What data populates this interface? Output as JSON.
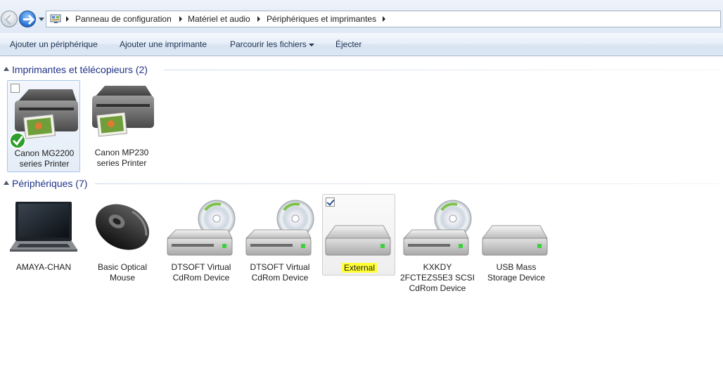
{
  "address": {
    "breadcrumb": [
      "Panneau de configuration",
      "Matériel et audio",
      "Périphériques et imprimantes"
    ],
    "icon": "control-panel-icon"
  },
  "toolbar": {
    "add_device": "Ajouter un périphérique",
    "add_printer": "Ajouter une imprimante",
    "browse_files": "Parcourir les fichiers",
    "eject": "Éjecter"
  },
  "groups": {
    "printers": {
      "title": "Imprimantes et télécopieurs (2)",
      "items": [
        {
          "line1": "Canon MG2200",
          "line2": "series Printer",
          "icon": "printer-icon",
          "default": true
        },
        {
          "line1": "Canon MP230",
          "line2": "series Printer",
          "icon": "printer-icon"
        }
      ]
    },
    "devices": {
      "title": "Périphériques (7)",
      "items": [
        {
          "line1": "AMAYA-CHAN",
          "line2": "",
          "line3": "",
          "icon": "laptop-icon"
        },
        {
          "line1": "Basic Optical",
          "line2": "Mouse",
          "line3": "",
          "icon": "mouse-icon"
        },
        {
          "line1": "DTSOFT Virtual",
          "line2": "CdRom Device",
          "line3": "",
          "icon": "cdrom-drive-icon"
        },
        {
          "line1": "DTSOFT Virtual",
          "line2": "CdRom Device",
          "line3": "",
          "icon": "cdrom-drive-icon"
        },
        {
          "line1": "External",
          "line2": "",
          "line3": "",
          "icon": "hard-drive-icon",
          "checked": true
        },
        {
          "line1": "KXKDY",
          "line2": "2FCTEZS5E3 SCSI",
          "line3": "CdRom Device",
          "icon": "cdrom-drive-icon"
        },
        {
          "line1": "USB Mass",
          "line2": "Storage Device",
          "line3": "",
          "icon": "hard-drive-icon"
        }
      ]
    }
  },
  "colors": {
    "group_title": "#1e3287",
    "highlight": "#ffff33",
    "selection": "#e4edf8"
  }
}
